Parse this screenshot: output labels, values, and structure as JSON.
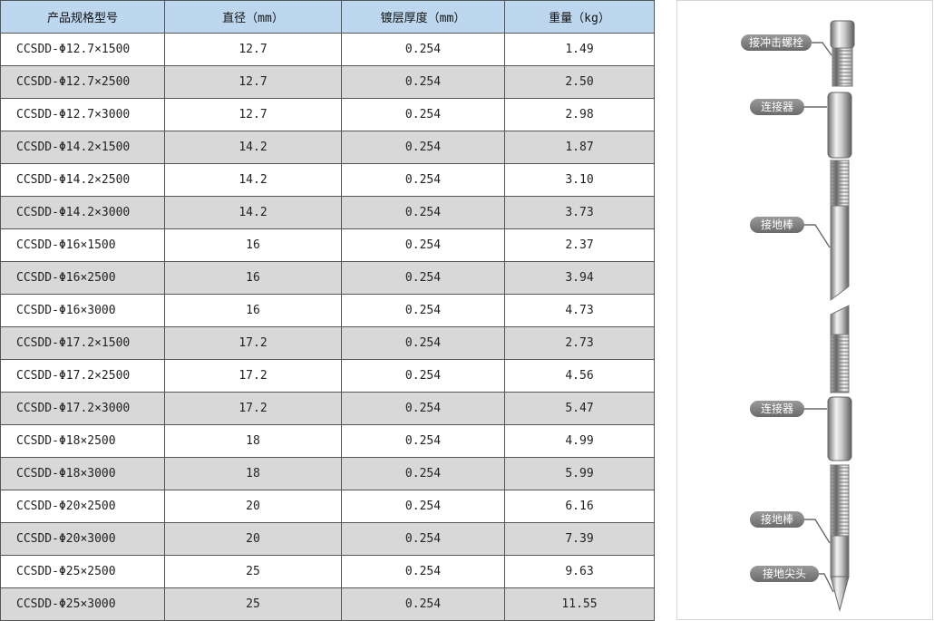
{
  "table": {
    "headers": [
      "产品规格型号",
      "直径（mm）",
      "镀层厚度（mm）",
      "重量（kg）"
    ],
    "rows": [
      [
        "CCSDD-Φ12.7×1500",
        "12.7",
        "0.254",
        "1.49"
      ],
      [
        "CCSDD-Φ12.7×2500",
        "12.7",
        "0.254",
        "2.50"
      ],
      [
        "CCSDD-Φ12.7×3000",
        "12.7",
        "0.254",
        "2.98"
      ],
      [
        "CCSDD-Φ14.2×1500",
        "14.2",
        "0.254",
        "1.87"
      ],
      [
        "CCSDD-Φ14.2×2500",
        "14.2",
        "0.254",
        "3.10"
      ],
      [
        "CCSDD-Φ14.2×3000",
        "14.2",
        "0.254",
        "3.73"
      ],
      [
        "CCSDD-Φ16×1500",
        "16",
        "0.254",
        "2.37"
      ],
      [
        "CCSDD-Φ16×2500",
        "16",
        "0.254",
        "3.94"
      ],
      [
        "CCSDD-Φ16×3000",
        "16",
        "0.254",
        "4.73"
      ],
      [
        "CCSDD-Φ17.2×1500",
        "17.2",
        "0.254",
        "2.73"
      ],
      [
        "CCSDD-Φ17.2×2500",
        "17.2",
        "0.254",
        "4.56"
      ],
      [
        "CCSDD-Φ17.2×3000",
        "17.2",
        "0.254",
        "5.47"
      ],
      [
        "CCSDD-Φ18×2500",
        "18",
        "0.254",
        "4.99"
      ],
      [
        "CCSDD-Φ18×3000",
        "18",
        "0.254",
        "5.99"
      ],
      [
        "CCSDD-Φ20×2500",
        "20",
        "0.254",
        "6.16"
      ],
      [
        "CCSDD-Φ20×3000",
        "20",
        "0.254",
        "7.39"
      ],
      [
        "CCSDD-Φ25×2500",
        "25",
        "0.254",
        "9.63"
      ],
      [
        "CCSDD-Φ25×3000",
        "25",
        "0.254",
        "11.55"
      ]
    ]
  },
  "diagram": {
    "labels": {
      "impact_bolt": "接冲击螺栓",
      "connector_1": "连接器",
      "ground_rod_1": "接地棒",
      "connector_2": "连接器",
      "ground_rod_2": "接地棒",
      "ground_tip": "接地尖头"
    }
  },
  "colors": {
    "header_bg": "#bdd7ee",
    "stripe_bg": "#d8d8d8",
    "label_bg": "#7f7f7f"
  }
}
